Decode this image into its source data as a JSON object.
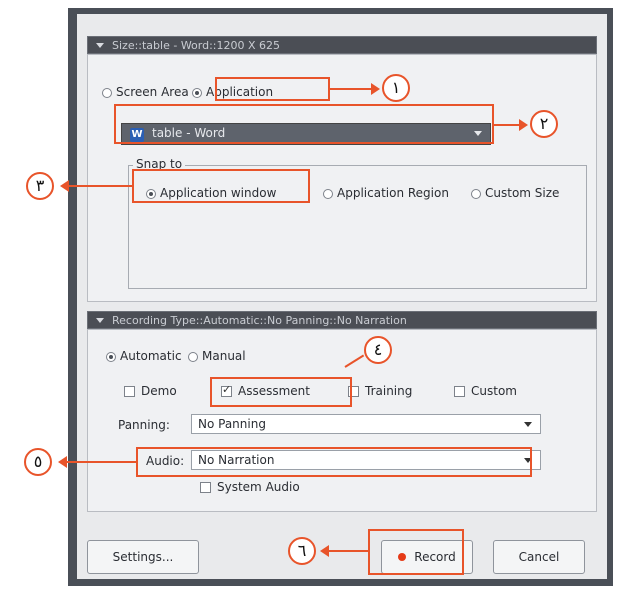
{
  "size_section": {
    "header": "Size::table - Word::1200 X 625",
    "option_screen_area": "Screen Area",
    "option_application": "Application",
    "selected": "Application",
    "app_dropdown_value": "table - Word",
    "app_icon_letter": "W",
    "snap_to_title": "Snap to",
    "snap_options": [
      "Application window",
      "Application Region",
      "Custom Size"
    ],
    "snap_selected": "Application window"
  },
  "recording_section": {
    "header": "Recording Type::Automatic::No Panning::No Narration",
    "mode_automatic": "Automatic",
    "mode_manual": "Manual",
    "mode_selected": "Automatic",
    "types": [
      {
        "label": "Demo",
        "checked": false
      },
      {
        "label": "Assessment",
        "checked": true
      },
      {
        "label": "Training",
        "checked": false
      },
      {
        "label": "Custom",
        "checked": false
      }
    ],
    "panning_label": "Panning:",
    "panning_value": "No Panning",
    "audio_label": "Audio:",
    "audio_value": "No Narration",
    "system_audio_label": "System Audio",
    "system_audio_checked": false
  },
  "buttons": {
    "settings": "Settings...",
    "record": "Record",
    "cancel": "Cancel"
  },
  "annotations": {
    "m1": "١",
    "m2": "٢",
    "m3": "٣",
    "m4": "٤",
    "m5": "٥",
    "m6": "٦",
    "color": "#e8542a"
  }
}
